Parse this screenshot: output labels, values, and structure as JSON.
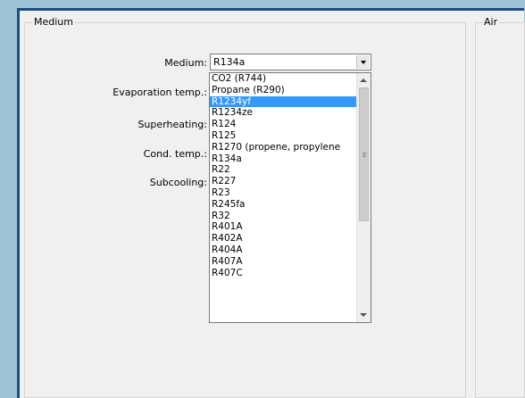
{
  "groups": {
    "medium_title": "Medium",
    "air_title": "Air"
  },
  "fields": {
    "medium_label": "Medium:",
    "evaporation_label": "Evaporation temp.:",
    "superheating_label": "Superheating:",
    "cond_label": "Cond. temp.:",
    "subcooling_label": "Subcooling:"
  },
  "combo": {
    "value": "R134a"
  },
  "dropdown": {
    "items": [
      "CO2 (R744)",
      "Propane (R290)",
      "R1234yf",
      "R1234ze",
      "R124",
      "R125",
      "R1270 (propene, propylene",
      "R134a",
      "R22",
      "R227",
      "R23",
      "R245fa",
      "R32",
      "R401A",
      "R402A",
      "R404A",
      "R407A",
      "R407C"
    ],
    "selected_index": 2
  },
  "colors": {
    "selection": "#3399ff",
    "window_border": "#1c4d80",
    "background": "#9fc3d4"
  }
}
